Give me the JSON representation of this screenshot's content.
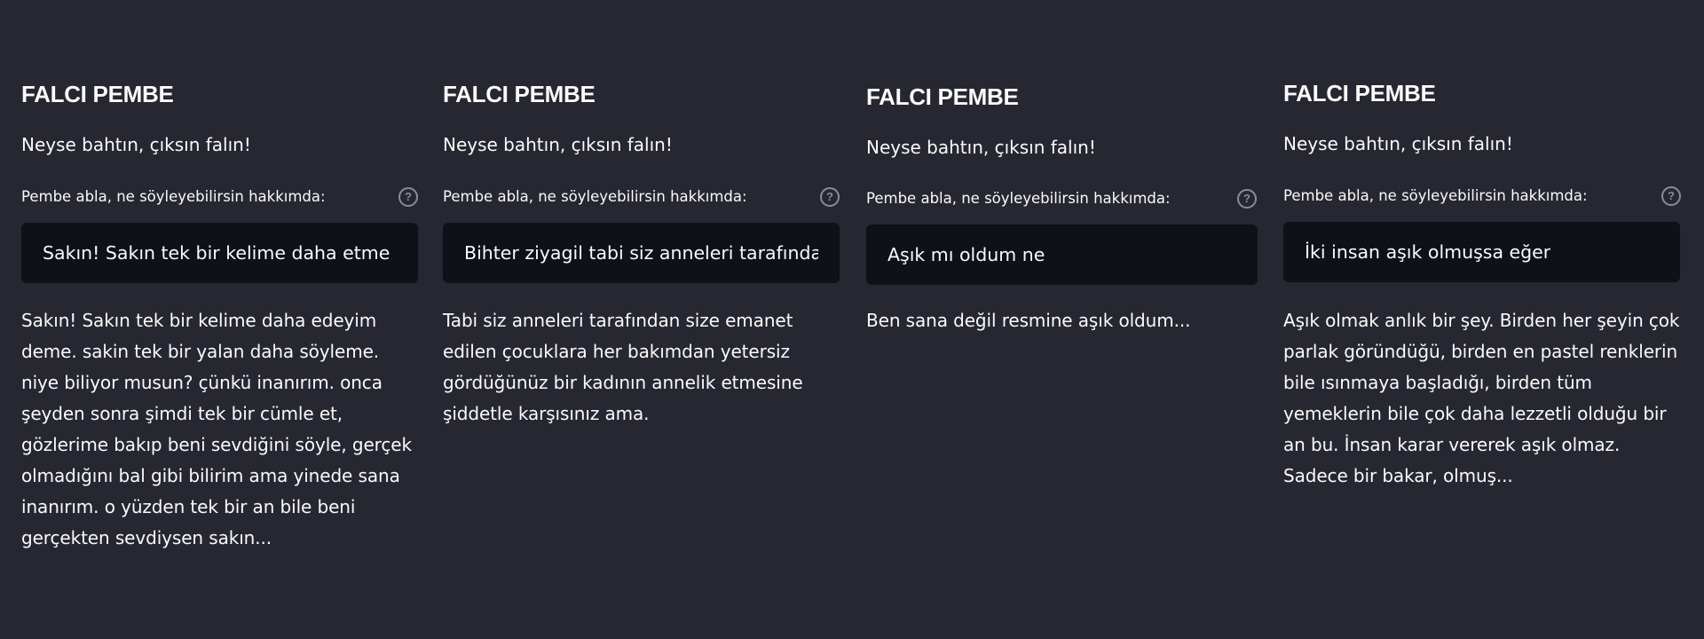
{
  "panels": [
    {
      "title": "FALCI PEMBE",
      "subtitle": "Neyse bahtın, çıksın falın!",
      "input_label": "Pembe abla, ne söyleyebilirsin hakkımda:",
      "help_icon": "question-circle-icon",
      "input_value": "Sakın! Sakın tek bir kelime daha etme",
      "response": "Sakın! Sakın tek bir kelime daha edeyim deme. sakin tek bir yalan daha söyleme. niye biliyor musun? çünkü inanırım. onca şeyden sonra şimdi tek bir cümle et, gözlerime bakıp beni sevdiğini söyle, gerçek olmadığını bal gibi bilirim ama yinede sana inanırım. o yüzden tek bir an bile beni gerçekten sevdiysen sakın..."
    },
    {
      "title": "FALCI PEMBE",
      "subtitle": "Neyse bahtın, çıksın falın!",
      "input_label": "Pembe abla, ne söyleyebilirsin hakkımda:",
      "help_icon": "question-circle-icon",
      "input_value": "Bihter ziyagil tabi siz anneleri tarafından",
      "response": "Tabi siz anneleri tarafından size emanet edilen çocuklara her bakımdan yetersiz gördüğünüz bir kadının annelik etmesine şiddetle karşısınız ama."
    },
    {
      "title": "FALCI PEMBE",
      "subtitle": "Neyse bahtın, çıksın falın!",
      "input_label": "Pembe abla, ne söyleyebilirsin hakkımda:",
      "help_icon": "question-circle-icon",
      "input_value": "Aşık mı oldum ne",
      "response": "Ben sana değil resmine aşık oldum..."
    },
    {
      "title": "FALCI PEMBE",
      "subtitle": "Neyse bahtın, çıksın falın!",
      "input_label": "Pembe abla, ne söyleyebilirsin hakkımda:",
      "help_icon": "question-circle-icon",
      "input_value": "İki insan aşık olmuşsa eğer",
      "response": "Aşık olmak anlık bir şey. Birden her şeyin çok parlak göründüğü, birden en pastel renklerin bile ısınmaya başladığı, birden tüm yemeklerin bile çok daha lezzetli olduğu bir an bu. İnsan karar vererek aşık olmaz. Sadece bir bakar, olmuş..."
    }
  ],
  "colors": {
    "background": "#262731",
    "input_background": "#0e1117",
    "text": "#fafafa",
    "help_icon": "#8b8c95"
  }
}
